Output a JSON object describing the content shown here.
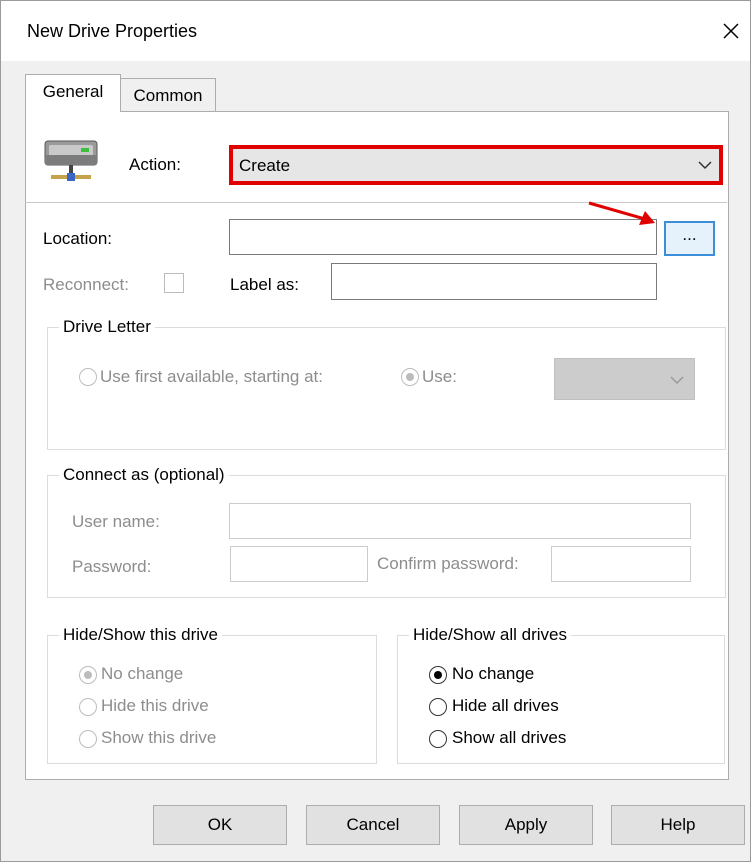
{
  "window": {
    "title": "New Drive Properties",
    "close_icon": "close-icon"
  },
  "tabs": [
    {
      "label": "General",
      "active": true
    },
    {
      "label": "Common",
      "active": false
    }
  ],
  "general": {
    "drive_icon": "network-drive-icon",
    "action": {
      "label": "Action:",
      "selected": "Create",
      "highlight_color": "#e00000"
    },
    "location": {
      "label": "Location:",
      "value": "",
      "browse_label": "..."
    },
    "annotation_arrow_color": "#e00000",
    "reconnect": {
      "label": "Reconnect:",
      "checked": false
    },
    "label_as": {
      "label": "Label as:",
      "value": ""
    },
    "drive_letter": {
      "legend": "Drive Letter",
      "use_first_available_label": "Use first available, starting at:",
      "use_label": "Use:",
      "selected_option": "use",
      "letter_value": ""
    },
    "connect_as": {
      "legend": "Connect as (optional)",
      "user_name_label": "User name:",
      "user_name_value": "",
      "password_label": "Password:",
      "password_value": "",
      "confirm_password_label": "Confirm password:",
      "confirm_password_value": ""
    },
    "hide_show_this_drive": {
      "legend": "Hide/Show this drive",
      "options": [
        "No change",
        "Hide this drive",
        "Show this drive"
      ],
      "selected": "No change"
    },
    "hide_show_all_drives": {
      "legend": "Hide/Show all drives",
      "options": [
        "No change",
        "Hide all drives",
        "Show all drives"
      ],
      "selected": "No change"
    }
  },
  "buttons": {
    "ok": "OK",
    "cancel": "Cancel",
    "apply": "Apply",
    "help": "Help"
  }
}
